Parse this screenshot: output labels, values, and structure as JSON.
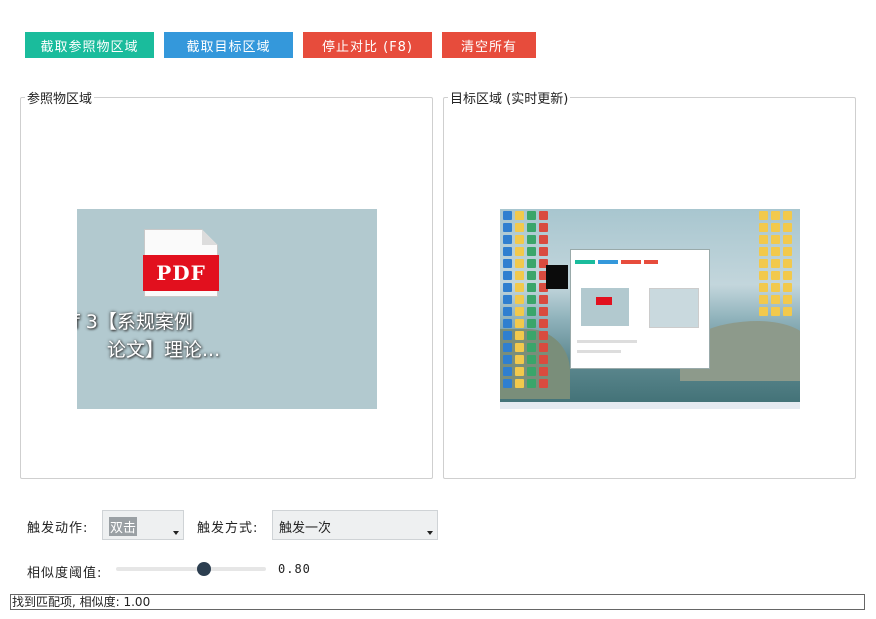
{
  "toolbar": {
    "capture_ref": "截取参照物区域",
    "capture_target": "截取目标区域",
    "stop_compare": "停止对比 (F8)",
    "clear_all": "清空所有"
  },
  "colors": {
    "capture_ref": "#1abc9c",
    "capture_target": "#3498db",
    "stop_compare": "#e74c3c",
    "clear_all": "#e74c3c",
    "slider_knob": "#2c3e50"
  },
  "reference_panel": {
    "title": "参照物区域",
    "image": {
      "badge": "PDF",
      "caption_line1": "f  3【系规案例",
      "caption_line2": "论文】理论..."
    }
  },
  "target_panel": {
    "title": "目标区域 (实时更新)"
  },
  "controls": {
    "trigger_action_label": "触发动作:",
    "trigger_action_value": "双击",
    "trigger_mode_label": "触发方式:",
    "trigger_mode_value": "触发一次",
    "similarity_label": "相似度阈值:",
    "similarity_value": 0.8,
    "similarity_display": "0.80"
  },
  "status_bar": {
    "text": "找到匹配项, 相似度: 1.00"
  }
}
